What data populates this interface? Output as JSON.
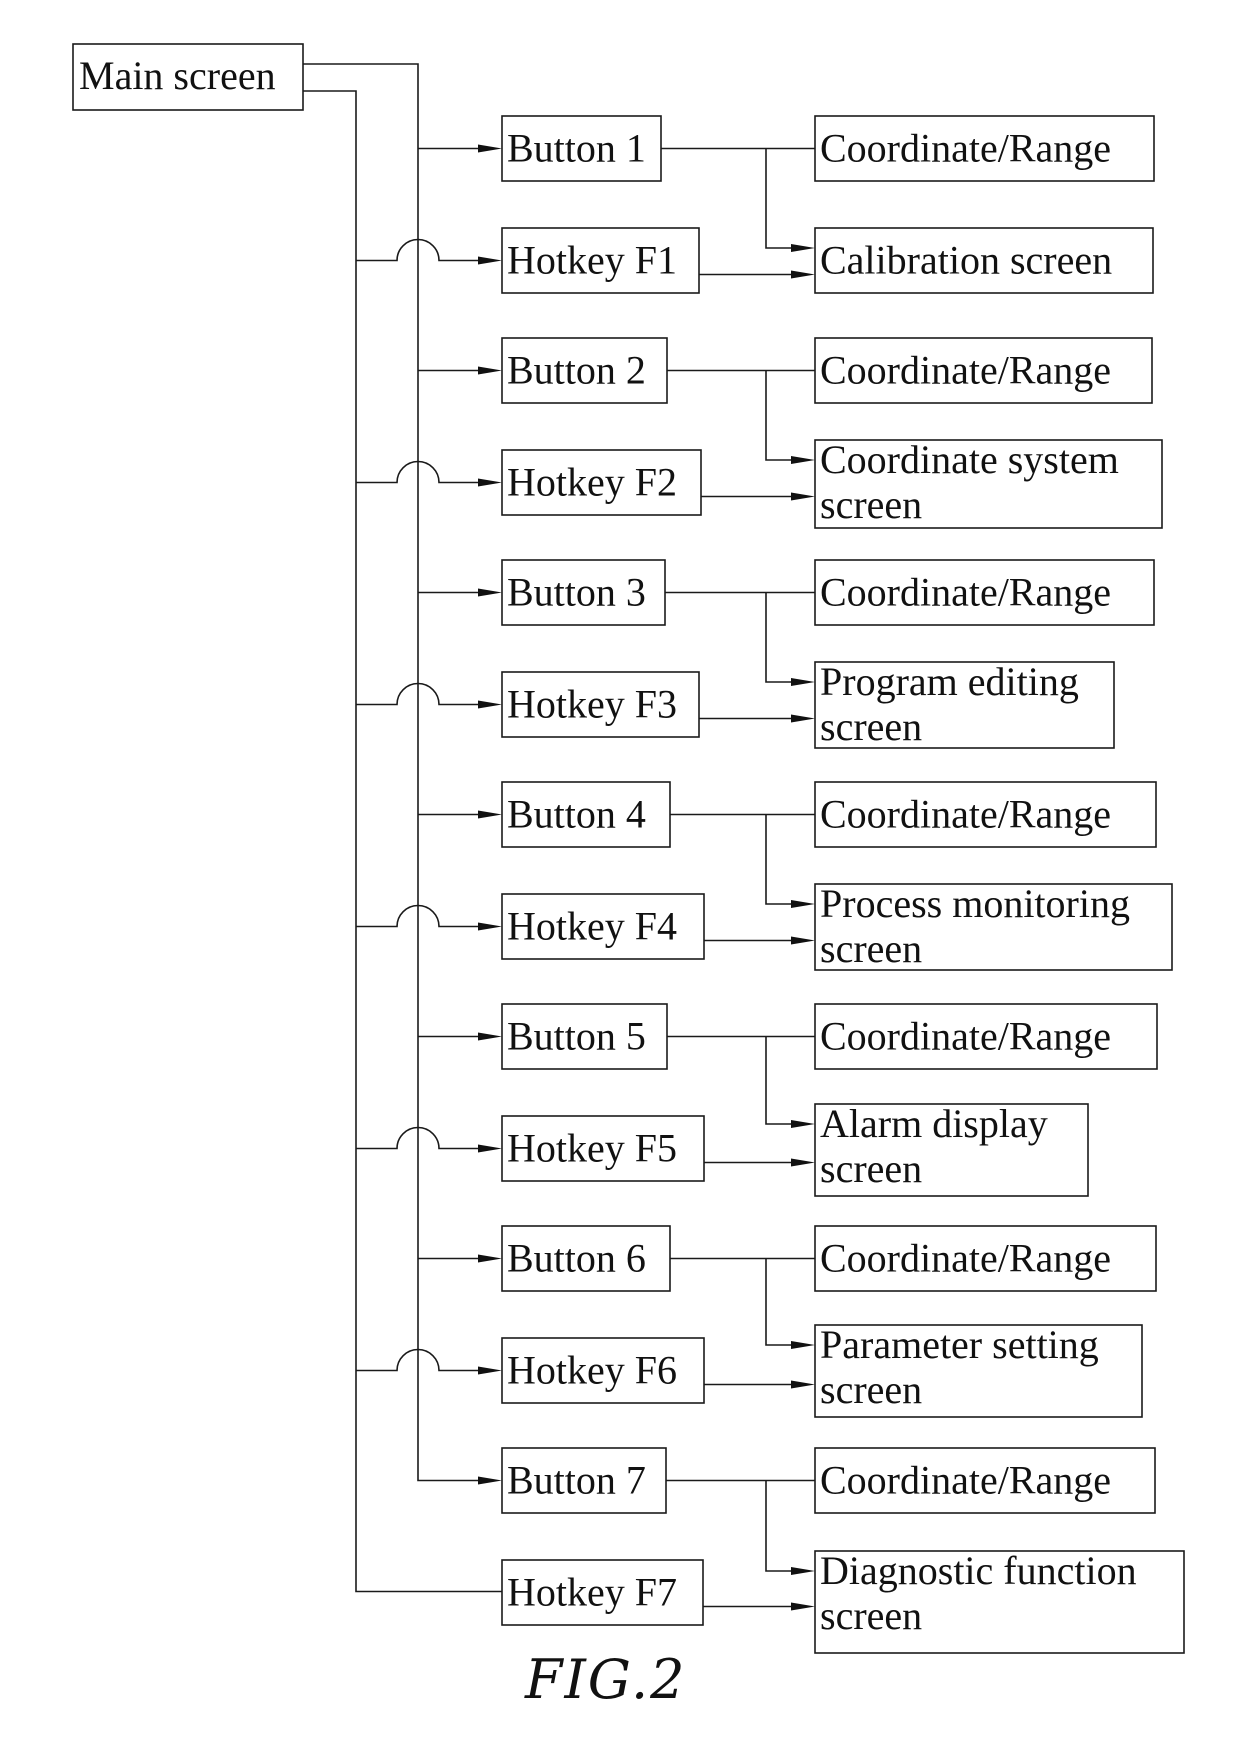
{
  "diagram": {
    "type": "flowchart",
    "root": {
      "id": "main",
      "label": "Main screen"
    },
    "rows": [
      {
        "button": "Button 1",
        "hotkey": "Hotkey F1",
        "coord": "Coordinate/Range",
        "screen": [
          "Calibration screen"
        ]
      },
      {
        "button": "Button 2",
        "hotkey": "Hotkey F2",
        "coord": "Coordinate/Range",
        "screen": [
          "Coordinate system",
          "screen"
        ]
      },
      {
        "button": "Button 3",
        "hotkey": "Hotkey F3",
        "coord": "Coordinate/Range",
        "screen": [
          "Program editing",
          "screen"
        ]
      },
      {
        "button": "Button 4",
        "hotkey": "Hotkey F4",
        "coord": "Coordinate/Range",
        "screen": [
          "Process monitoring",
          "screen"
        ]
      },
      {
        "button": "Button 5",
        "hotkey": "Hotkey F5",
        "coord": "Coordinate/Range",
        "screen": [
          "Alarm display",
          "screen"
        ]
      },
      {
        "button": "Button 6",
        "hotkey": "Hotkey F6",
        "coord": "Coordinate/Range",
        "screen": [
          "Parameter setting",
          "screen"
        ]
      },
      {
        "button": "Button 7",
        "hotkey": "Hotkey F7",
        "coord": "Coordinate/Range",
        "screen": [
          "Diagnostic function",
          "screen"
        ]
      }
    ],
    "edges": [
      "Main screen -> Button 1..7",
      "Main screen -> Hotkey F1..F7",
      "Button N -> Coordinate/Range",
      "Button N -> Screen N",
      "Hotkey FN -> Screen N"
    ],
    "caption": "FIG.2"
  }
}
